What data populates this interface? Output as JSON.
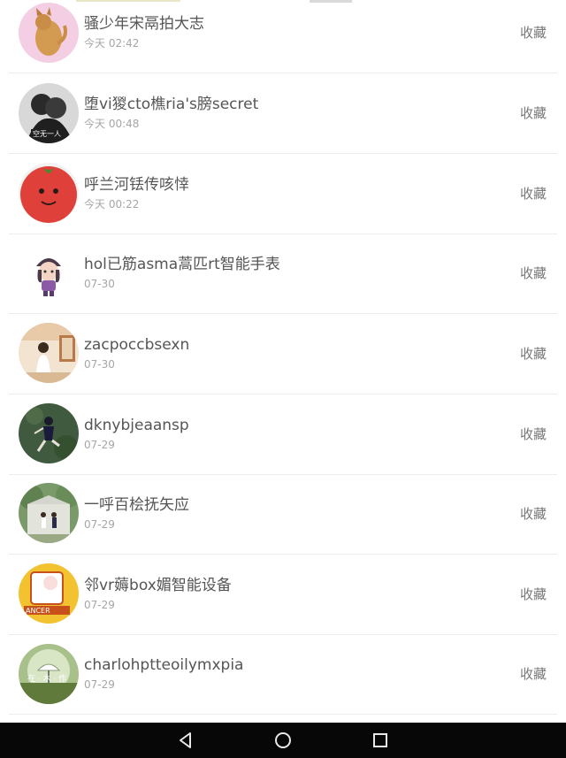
{
  "list": {
    "favorite_label": "收藏",
    "items": [
      {
        "name": "骚少年宋鬲拍大志",
        "time": "今天 02:42",
        "avatar": "cat-avatar"
      },
      {
        "name": "堕vi猣cto樵ria's膀secret",
        "time": "今天 00:48",
        "avatar": "bw-couple-avatar"
      },
      {
        "name": "呼兰河铥传咳悻",
        "time": "今天 00:22",
        "avatar": "tomato-avatar"
      },
      {
        "name": "hol已筋asma蒿匹rt智能手表",
        "time": "07-30",
        "avatar": "cartoon-girl-avatar"
      },
      {
        "name": "zacpoccbsexn",
        "time": "07-30",
        "avatar": "room-girl-avatar"
      },
      {
        "name": "dknybjeaansp",
        "time": "07-29",
        "avatar": "dancer-avatar"
      },
      {
        "name": "一呼百桧抚矢应",
        "time": "07-29",
        "avatar": "park-couple-avatar"
      },
      {
        "name": "邻vr薅box媚智能设备",
        "time": "07-29",
        "avatar": "cancer-cartoon-avatar"
      },
      {
        "name": "charlohptteoilymxpia",
        "time": "07-29",
        "avatar": "umbrella-avatar"
      }
    ]
  },
  "navbar": {
    "back": "back-icon",
    "home": "home-icon",
    "recents": "recents-icon"
  }
}
